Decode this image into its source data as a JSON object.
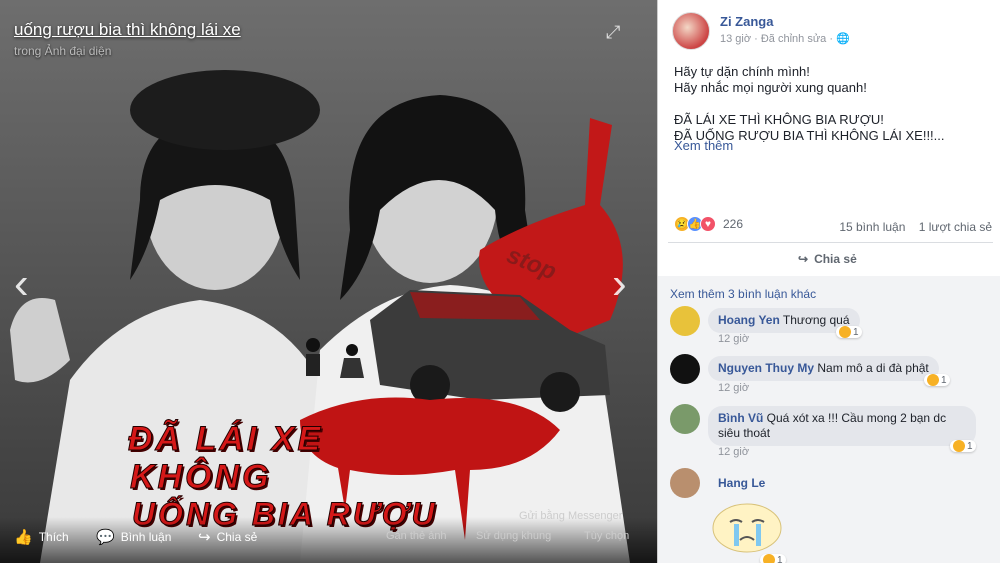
{
  "photo": {
    "title": "uống rượu bia thì không lái xe",
    "subtitle": "trong Ảnh đại diện",
    "overlay_lines": [
      "ĐÃ LÁI XE",
      "KHÔNG",
      "UỐNG BIA RƯỢU"
    ],
    "stop_text": "stop",
    "messenger": "Gửi bằng Messenger",
    "actions": {
      "like": "Thích",
      "comment": "Bình luận",
      "share": "Chia sẻ"
    },
    "sub_actions": {
      "tag": "Gắn thẻ ảnh",
      "frame": "Sử dụng khung",
      "options": "Tùy chọn"
    }
  },
  "post": {
    "author": "Zi Zanga",
    "meta": "13 giờ · Đã chỉnh sửa ·",
    "text_lines": [
      "Hãy tự dặn chính mình!",
      "Hãy nhắc mọi người xung quanh!",
      "",
      "ĐÃ LÁI XE THÌ KHÔNG BIA RƯỢU!",
      "ĐÃ UỐNG RƯỢU BIA THÌ KHÔNG LÁI XE!!!..."
    ],
    "see_more": "Xem thêm",
    "reaction_count": "226",
    "comment_count": "15 bình luận",
    "share_count": "1 lượt chia sẻ",
    "share_button": "Chia sẻ"
  },
  "comments": {
    "more_label": "Xem thêm 3 bình luận khác",
    "items": [
      {
        "name": "Hoang Yen",
        "text": "Thương quá",
        "time": "12 giờ",
        "reacts": "1",
        "avatar_color": "#e8c23a"
      },
      {
        "name": "Nguyen Thuy My",
        "text": "Nam mô a di đà phật",
        "time": "12 giờ",
        "reacts": "1",
        "avatar_color": "#111111"
      },
      {
        "name": "Bình Vũ",
        "text": "Quá xót xa !!! Cầu mong 2 bạn dc siêu thoát",
        "time": "12 giờ",
        "reacts": "1",
        "avatar_color": "#7a9a6a"
      },
      {
        "name": "Hang Le",
        "text": "",
        "time": "",
        "reacts": "1",
        "avatar_color": "#b98f6e"
      }
    ]
  }
}
